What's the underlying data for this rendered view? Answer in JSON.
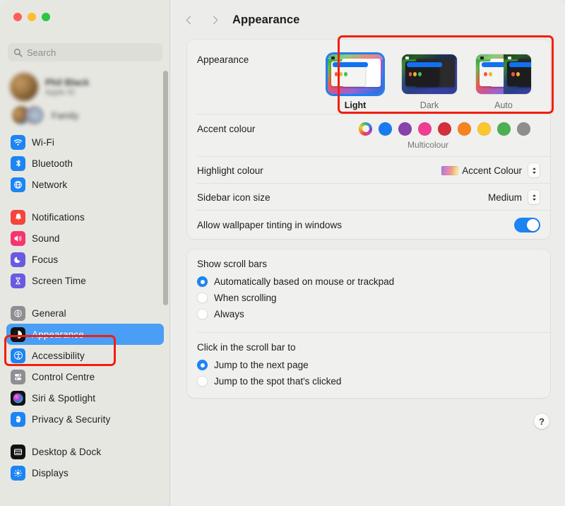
{
  "window": {
    "traffic_lights": [
      "close",
      "minimise",
      "maximise"
    ],
    "colors": {
      "close": "#ff5f57",
      "minimise": "#febc2e",
      "maximise": "#28c840",
      "accent_blue": "#1d84f3",
      "sidebar_selection": "#4a9ef5",
      "annotation_red": "#f21f0e"
    }
  },
  "sidebar": {
    "search": {
      "placeholder": "Search",
      "value": "",
      "icon": "search-icon"
    },
    "profile": {
      "name": "Phil Black",
      "subtitle": "Apple ID",
      "family_label": "Family",
      "blurred": true
    },
    "groups": [
      {
        "items": [
          {
            "label": "Wi-Fi",
            "icon": "wifi-icon"
          },
          {
            "label": "Bluetooth",
            "icon": "bluetooth-icon"
          },
          {
            "label": "Network",
            "icon": "network-icon"
          }
        ]
      },
      {
        "items": [
          {
            "label": "Notifications",
            "icon": "bell-icon"
          },
          {
            "label": "Sound",
            "icon": "speaker-icon"
          },
          {
            "label": "Focus",
            "icon": "moon-icon"
          },
          {
            "label": "Screen Time",
            "icon": "hourglass-icon"
          }
        ]
      },
      {
        "items": [
          {
            "label": "General",
            "icon": "gear-icon"
          },
          {
            "label": "Appearance",
            "icon": "appearance-icon",
            "selected": true
          },
          {
            "label": "Accessibility",
            "icon": "accessibility-icon"
          },
          {
            "label": "Control Centre",
            "icon": "control-centre-icon"
          },
          {
            "label": "Siri & Spotlight",
            "icon": "siri-icon"
          },
          {
            "label": "Privacy & Security",
            "icon": "hand-icon"
          }
        ]
      },
      {
        "items": [
          {
            "label": "Desktop & Dock",
            "icon": "desktop-dock-icon"
          },
          {
            "label": "Displays",
            "icon": "displays-icon"
          }
        ]
      }
    ]
  },
  "toolbar": {
    "back_icon": "chevron-left-icon",
    "forward_icon": "chevron-right-icon",
    "title": "Appearance"
  },
  "main": {
    "appearance": {
      "label": "Appearance",
      "options": [
        {
          "label": "Light",
          "selected": true
        },
        {
          "label": "Dark",
          "selected": false
        },
        {
          "label": "Auto",
          "selected": false
        }
      ]
    },
    "accent_colour": {
      "label": "Accent colour",
      "selected_name": "Multicolour",
      "swatches": [
        {
          "name": "Multicolour",
          "hex": "multicolour",
          "selected": true
        },
        {
          "name": "Blue",
          "hex": "#197bf0"
        },
        {
          "name": "Purple",
          "hex": "#8842ab"
        },
        {
          "name": "Pink",
          "hex": "#f03d94"
        },
        {
          "name": "Red",
          "hex": "#d32f3c"
        },
        {
          "name": "Orange",
          "hex": "#f5831f"
        },
        {
          "name": "Yellow",
          "hex": "#fbc72e"
        },
        {
          "name": "Green",
          "hex": "#4cb052"
        },
        {
          "name": "Graphite",
          "hex": "#8e8e8e"
        }
      ]
    },
    "highlight_colour": {
      "label": "Highlight colour",
      "value": "Accent Colour"
    },
    "sidebar_icon_size": {
      "label": "Sidebar icon size",
      "value": "Medium"
    },
    "wallpaper_tinting": {
      "label": "Allow wallpaper tinting in windows",
      "enabled": true
    },
    "show_scroll_bars": {
      "title": "Show scroll bars",
      "options": [
        {
          "label": "Automatically based on mouse or trackpad",
          "selected": true
        },
        {
          "label": "When scrolling",
          "selected": false
        },
        {
          "label": "Always",
          "selected": false
        }
      ]
    },
    "click_scroll_bar": {
      "title": "Click in the scroll bar to",
      "options": [
        {
          "label": "Jump to the next page",
          "selected": true
        },
        {
          "label": "Jump to the spot that's clicked",
          "selected": false
        }
      ]
    },
    "help_button": {
      "label": "?"
    }
  },
  "annotations": [
    {
      "name": "appearance-theme-highlight"
    },
    {
      "name": "sidebar-appearance-highlight"
    }
  ]
}
